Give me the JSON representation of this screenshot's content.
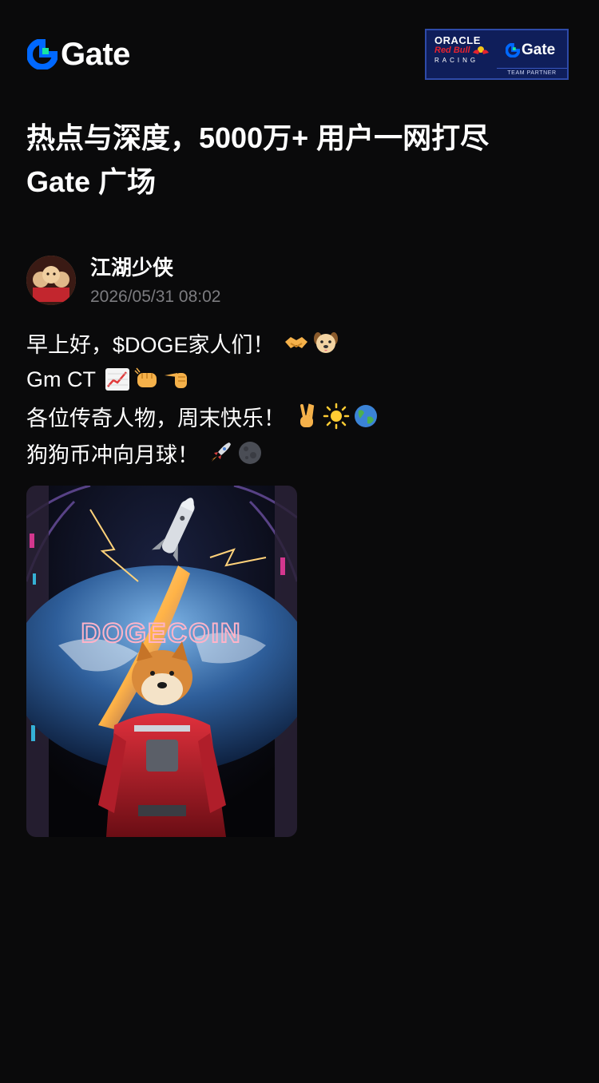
{
  "header": {
    "logo_text": "Gate",
    "partner_badge": {
      "line1": "ORACLE",
      "line2": "Red Bull",
      "line3": "RACING",
      "brand": "Gate",
      "footer": "TEAM PARTNER"
    }
  },
  "headline": {
    "line1": "热点与深度，5000万+ 用户一网打尽",
    "line2": "Gate 广场"
  },
  "post": {
    "author": "江湖少侠",
    "timestamp": "2026/05/31 08:02",
    "lines": [
      {
        "text": "早上好，$DOGE家人们！",
        "emojis": [
          "handshake-emoji",
          "dog-face-emoji"
        ]
      },
      {
        "text": "Gm CT",
        "emojis": [
          "chart-increasing-emoji",
          "fist-bump-emoji",
          "pointing-left-emoji"
        ]
      },
      {
        "text": "各位传奇人物，周末快乐！",
        "emojis": [
          "victory-hand-emoji",
          "sun-emoji",
          "globe-emoji"
        ]
      },
      {
        "text": "狗狗币冲向月球！",
        "emojis": [
          "rocket-emoji",
          "moon-emoji"
        ]
      }
    ],
    "image_text": "DOGECOIN"
  },
  "colors": {
    "background": "#0a0a0b",
    "brand_blue": "#0068ff",
    "brand_green": "#17e5a1",
    "muted_text": "#7c7c80"
  }
}
